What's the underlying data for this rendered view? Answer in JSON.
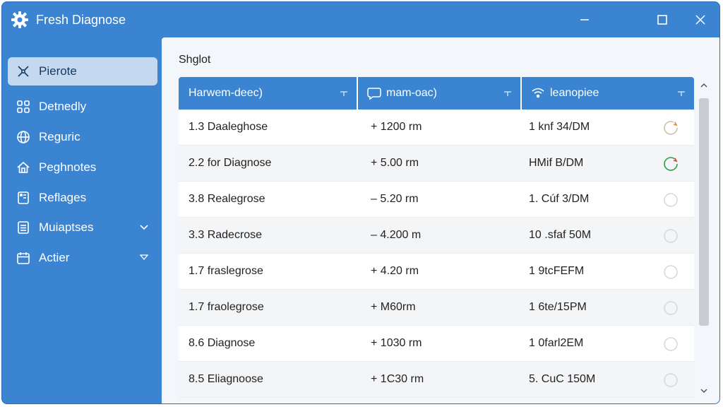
{
  "app": {
    "title": "Fresh Diagnose"
  },
  "sidebar": {
    "items": [
      {
        "label": "Pierote",
        "icon": "network-icon",
        "active": true
      },
      {
        "label": "Detnedly",
        "icon": "grid-icon"
      },
      {
        "label": "Reguric",
        "icon": "globe-icon"
      },
      {
        "label": "Peghnotes",
        "icon": "home-icon"
      },
      {
        "label": "Reflages",
        "icon": "document-icon",
        "expandable": false
      },
      {
        "label": "Muiaptses",
        "icon": "list-icon",
        "expandable": true
      },
      {
        "label": "Actier",
        "icon": "calendar-icon",
        "expandable": true
      }
    ]
  },
  "main": {
    "section_title": "Shglot",
    "columns": [
      {
        "label": "Harwem-deec)",
        "icon": null
      },
      {
        "label": "mam-oac)",
        "icon": "speech-bubble-icon"
      },
      {
        "label": "leanopiee",
        "icon": "wifi-icon"
      }
    ],
    "rows": [
      {
        "name": "1.3 Daaleghose",
        "value": "+  1200 rm",
        "time": "1 knf 34/DM",
        "status": "pending"
      },
      {
        "name": "2.2 for Diagnose",
        "value": "+  5.00 rm",
        "time": "HMif B/DM",
        "status": "ok"
      },
      {
        "name": "3.8 Realegrose",
        "value": "–  5.20 rm",
        "time": "1. Cúf 3/DM",
        "status": "idle"
      },
      {
        "name": "3.3 Radecrose",
        "value": "–  4.200 m",
        "time": "10 .sfaf 50M",
        "status": "idle"
      },
      {
        "name": "1.7 fraslegrose",
        "value": "+  4.20 rm",
        "time": "1 9tcFEFM",
        "status": "idle"
      },
      {
        "name": "1.7 fraolegrose",
        "value": "+  M60rm",
        "time": "1 6te/15PM",
        "status": "idle"
      },
      {
        "name": "8.6 Diagnose",
        "value": "+  1030 rm",
        "time": "1 0farl2EM",
        "status": "idle"
      },
      {
        "name": "8.5 Eliagnoose",
        "value": "+  1C30 rm",
        "time": "5. CuC 150M",
        "status": "idle"
      }
    ]
  },
  "colors": {
    "accent": "#3a84d2",
    "active_nav": "#c4d9f0",
    "status_ok": "#2e9e44",
    "status_warn": "#e08a3c",
    "status_idle": "#d6d9dd"
  }
}
